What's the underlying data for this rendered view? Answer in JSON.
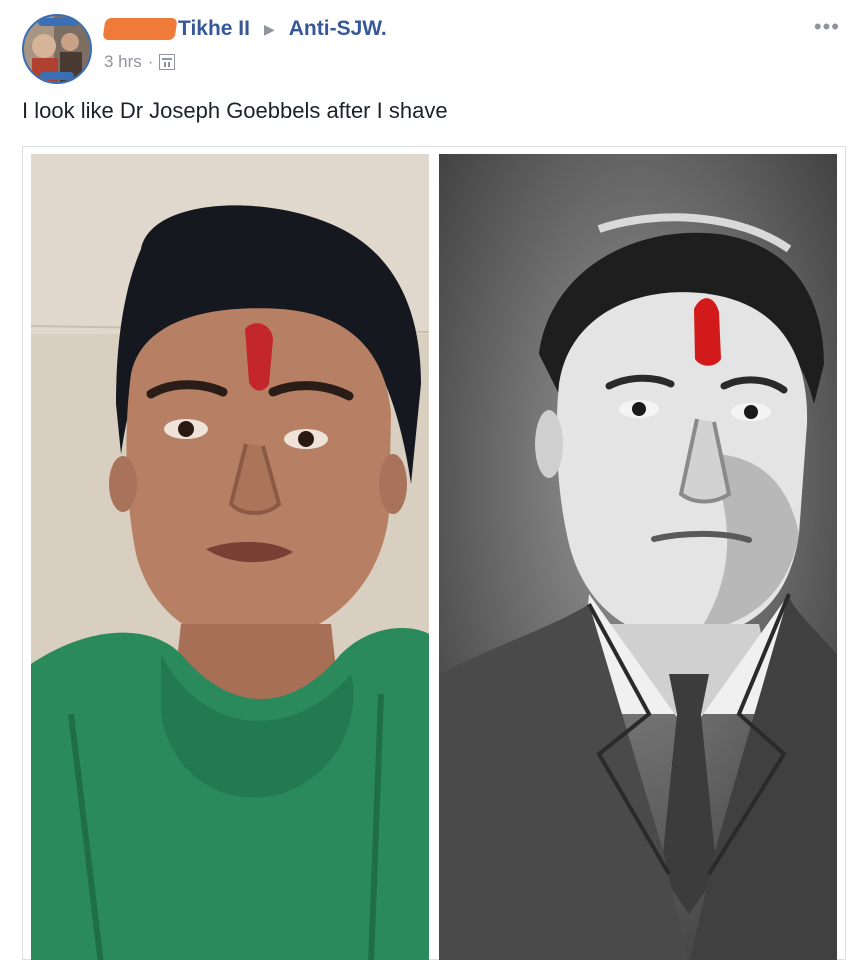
{
  "post": {
    "author": "Tikhe II",
    "group": "Anti-SJW.",
    "timestamp": "3 hrs",
    "separator": "·",
    "more_label": "•••",
    "text": "I look like Dr Joseph Goebbels after I shave"
  },
  "icons": {
    "arrow": "right-triangle-icon",
    "privacy": "group-privacy-icon",
    "more": "more-options-icon"
  },
  "colors": {
    "link": "#365899",
    "meta": "#90949c",
    "text": "#1d2129",
    "redaction": "#f07a3a"
  }
}
